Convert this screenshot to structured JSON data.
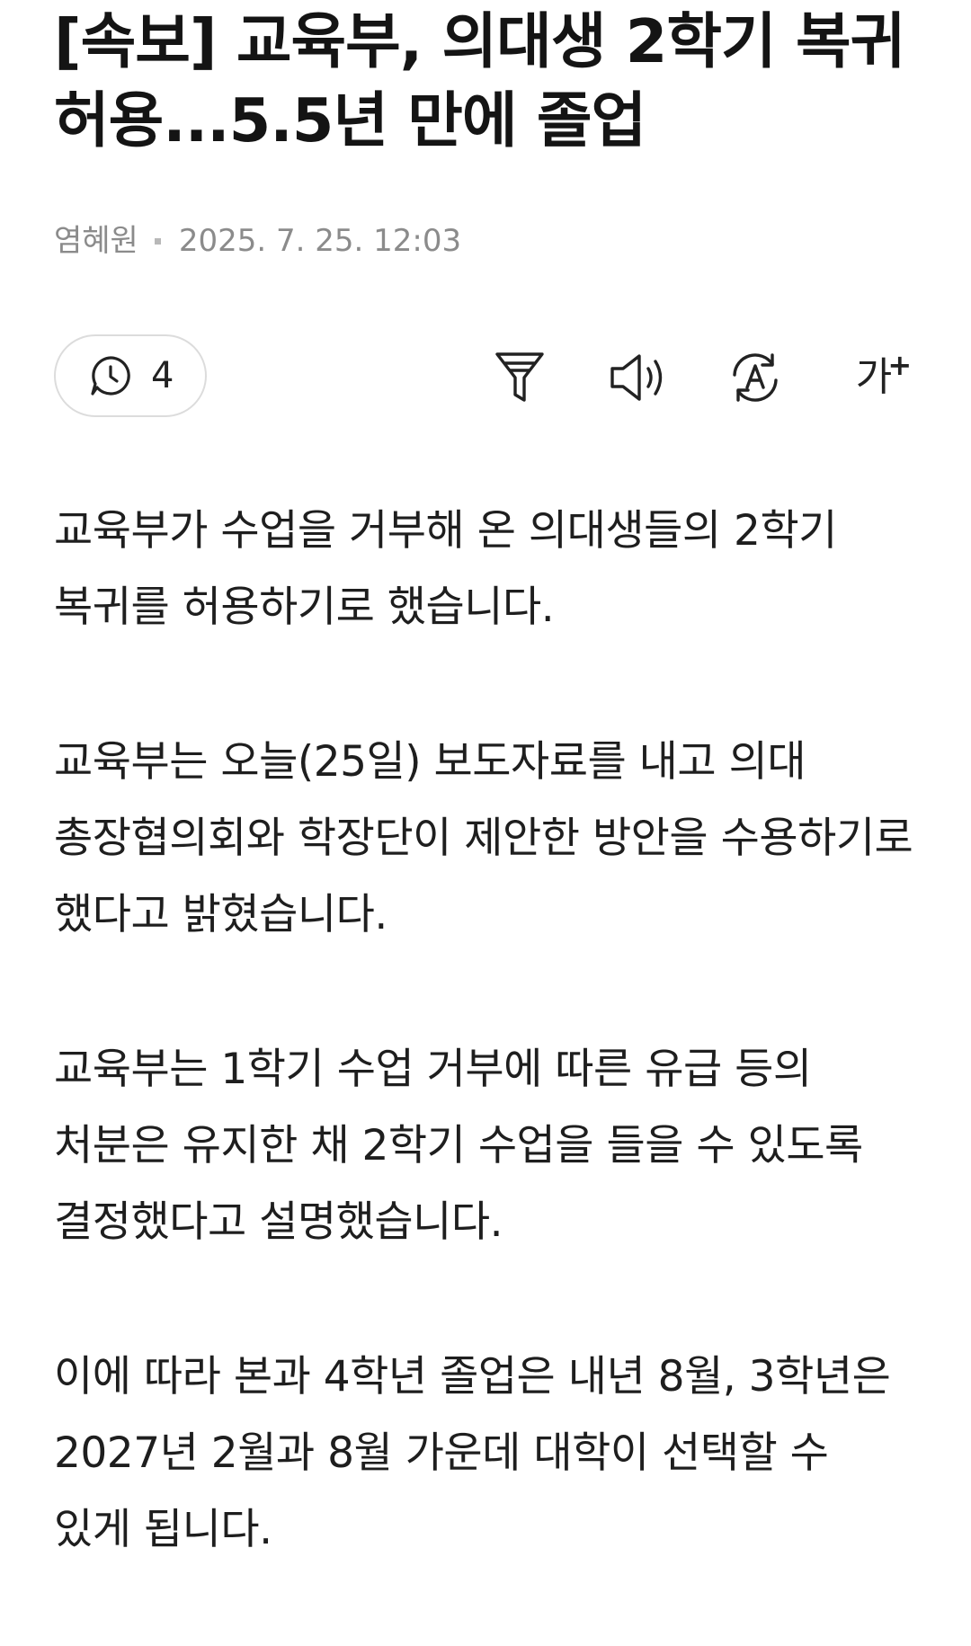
{
  "article": {
    "title": "[속보] 교육부, 의대생 2학기 복귀 허용...5.5년 만에 졸업",
    "author": "염혜원",
    "date": "2025. 7. 25. 12:03"
  },
  "toolbar": {
    "comment_count": "4",
    "fontsize_label": "가",
    "fontsize_plus": "+",
    "icons": [
      "comment-icon",
      "summary-filter-icon",
      "speaker-icon",
      "translate-icon",
      "font-size-icon"
    ]
  },
  "body": {
    "paragraphs": [
      "교육부가 수업을 거부해 온 의대생들의 2학기 복귀를 허용하기로 했습니다.",
      "교육부는 오늘(25일) 보도자료를 내고 의대 총장협의회와 학장단이 제안한 방안을 수용하기로 했다고 밝혔습니다.",
      "교육부는 1학기 수업 거부에 따른 유급 등의 처분은 유지한 채 2학기 수업을 들을 수 있도록 결정했다고 설명했습니다.",
      "이에 따라 본과 4학년 졸업은 내년 8월, 3학년은 2027년 2월과 8월 가운데 대학이 선택할 수 있게 됩니다."
    ]
  }
}
